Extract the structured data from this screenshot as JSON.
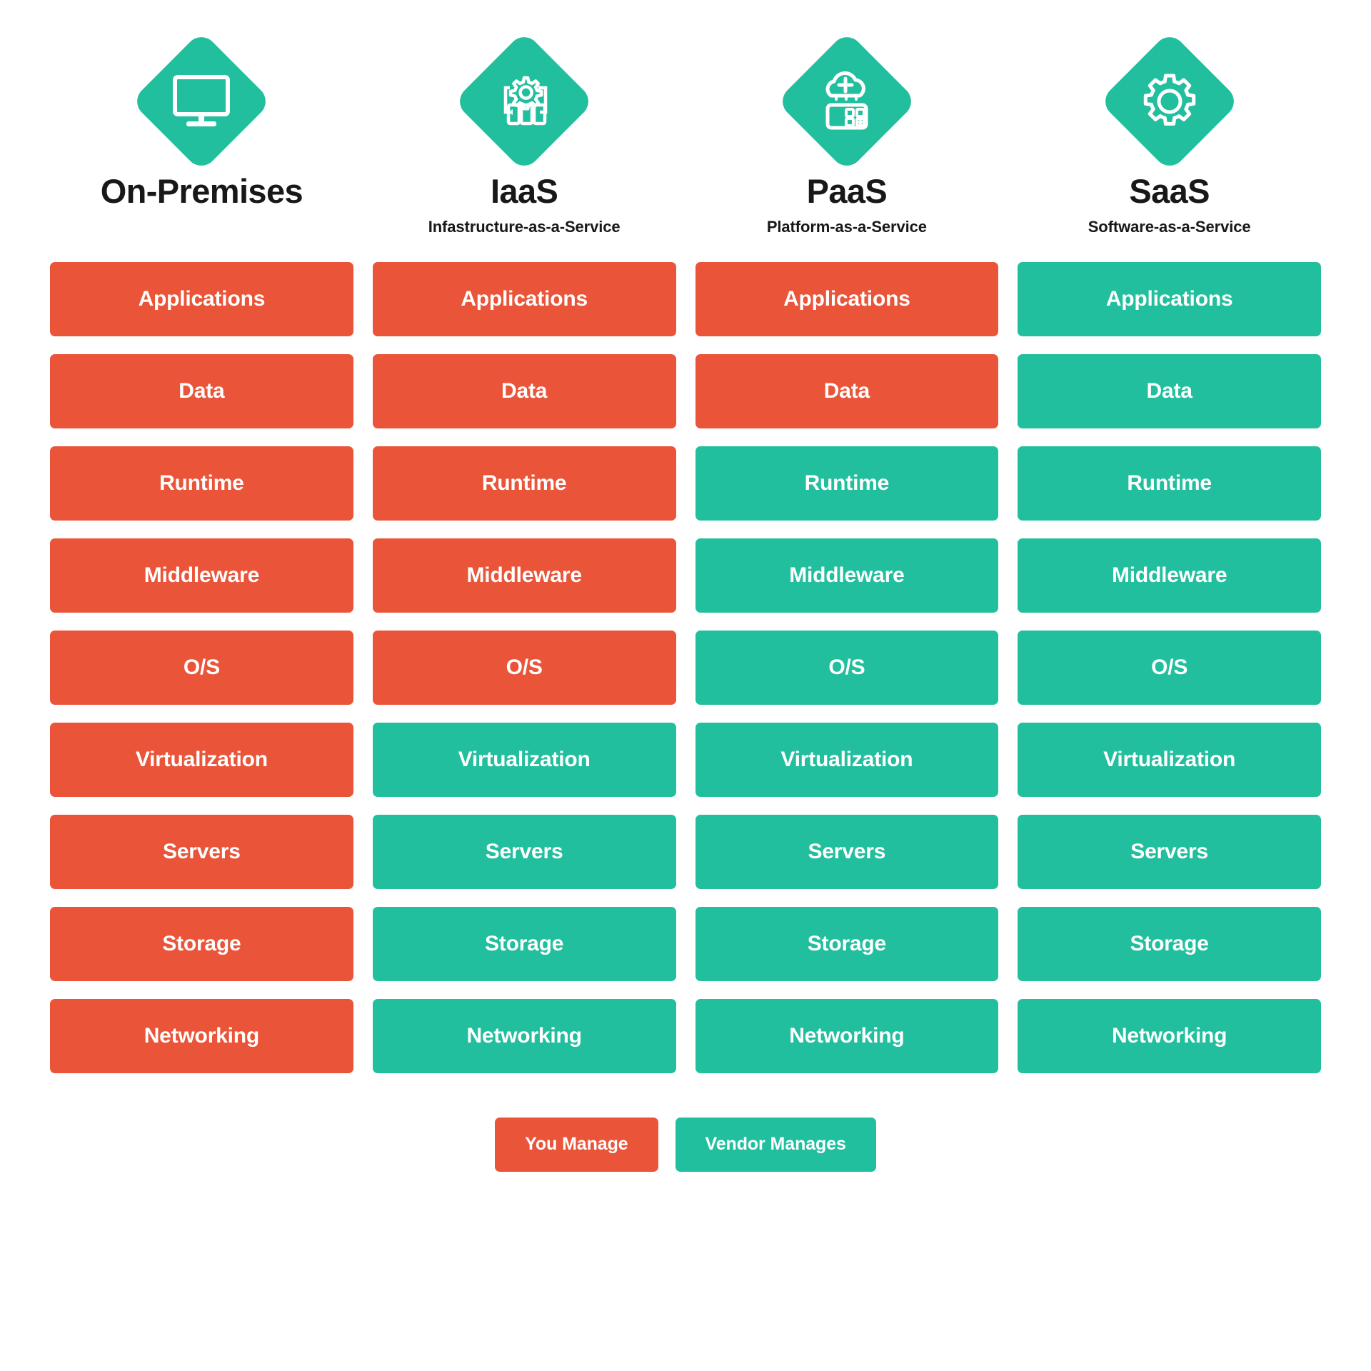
{
  "page": {
    "background_color": "#FFFFFF",
    "title_text_color": "#17181A"
  },
  "colors": {
    "you_manage": "#EA5439",
    "vendor_manages": "#22BF9E",
    "label_text": "#FFFFFF"
  },
  "columns": [
    {
      "id": "on-premises",
      "title": "On-Premises",
      "subtitle": "",
      "icon": "monitor-icon"
    },
    {
      "id": "iaas",
      "title": "IaaS",
      "subtitle": "Infastructure-as-a-Service",
      "icon": "infrastructure-gear-icon"
    },
    {
      "id": "paas",
      "title": "PaaS",
      "subtitle": "Platform-as-a-Service",
      "icon": "cloud-platform-icon"
    },
    {
      "id": "saas",
      "title": "SaaS",
      "subtitle": "Software-as-a-Service",
      "icon": "gear-icon"
    }
  ],
  "layers": [
    "Applications",
    "Data",
    "Runtime",
    "Middleware",
    "O/S",
    "Virtualization",
    "Servers",
    "Storage",
    "Networking"
  ],
  "legend": {
    "you_manage_label": "You Manage",
    "vendor_manages_label": "Vendor Manages"
  },
  "chart_data": {
    "type": "heatmap",
    "title": "",
    "categories": [
      "On-Premises",
      "IaaS",
      "PaaS",
      "SaaS"
    ],
    "rows": [
      "Applications",
      "Data",
      "Runtime",
      "Middleware",
      "O/S",
      "Virtualization",
      "Servers",
      "Storage",
      "Networking"
    ],
    "legend_entries": [
      {
        "label": "You Manage",
        "color": "#EA5439",
        "value": "you"
      },
      {
        "label": "Vendor Manages",
        "color": "#22BF9E",
        "value": "vendor"
      }
    ],
    "legend_position": "bottom-center",
    "grid": false,
    "values": [
      [
        "you",
        "you",
        "you",
        "vendor"
      ],
      [
        "you",
        "you",
        "you",
        "vendor"
      ],
      [
        "you",
        "you",
        "vendor",
        "vendor"
      ],
      [
        "you",
        "you",
        "vendor",
        "vendor"
      ],
      [
        "you",
        "you",
        "vendor",
        "vendor"
      ],
      [
        "you",
        "vendor",
        "vendor",
        "vendor"
      ],
      [
        "you",
        "vendor",
        "vendor",
        "vendor"
      ],
      [
        "you",
        "vendor",
        "vendor",
        "vendor"
      ],
      [
        "you",
        "vendor",
        "vendor",
        "vendor"
      ]
    ]
  }
}
